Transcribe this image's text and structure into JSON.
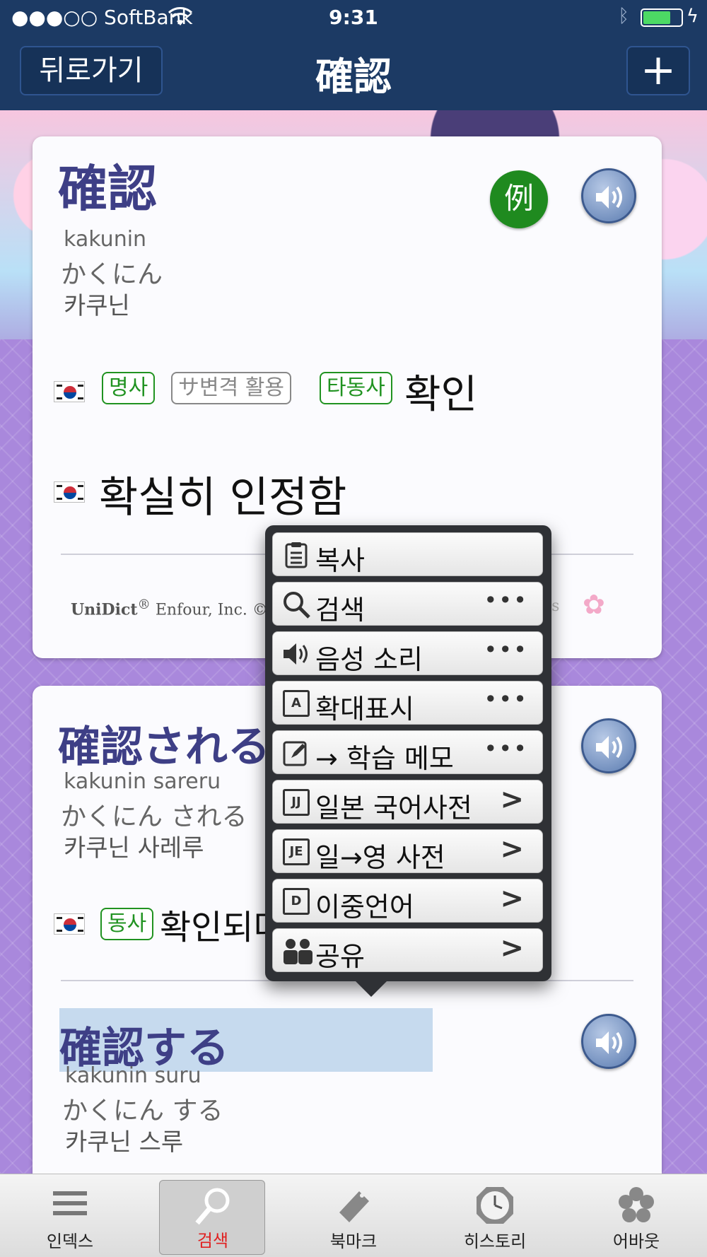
{
  "status_bar": {
    "carrier": "●●●○○ SoftBank",
    "time": "9:31",
    "wifi_icon": "wifi-icon",
    "bluetooth_icon": "bluetooth-icon",
    "battery_icon": "battery-icon",
    "charging_icon": "charging-icon"
  },
  "nav": {
    "back_label": "뒤로가기",
    "title": "確認",
    "add_label": "+"
  },
  "entries": [
    {
      "headword": "確認",
      "romaji": "kakunin",
      "kana": "かくにん",
      "hangul": "카쿠닌",
      "example_badge": "例",
      "senses": [
        {
          "tags": [
            "명사",
            "サ변격 활용",
            "타동사"
          ],
          "meaning": "확인"
        },
        {
          "tags": [],
          "meaning": "확실히 인정함"
        }
      ],
      "copyright_brand": "UniDict",
      "copyright_rest": " Enfour, Inc. ©",
      "copyright_tail": "lis"
    },
    {
      "headword": "確認される",
      "romaji": "kakunin sareru",
      "kana": "かくにん される",
      "hangul": "카쿠닌 사레루",
      "senses": [
        {
          "tags": [
            "동사"
          ],
          "meaning": "확인되다"
        }
      ]
    },
    {
      "headword": "確認する",
      "romaji": "kakunin suru",
      "kana": "かくにん する",
      "hangul": "카쿠닌 스루"
    }
  ],
  "popup_menu": {
    "items": [
      {
        "label": "복사",
        "icon": "clipboard-icon",
        "accessory": ""
      },
      {
        "label": "검색",
        "icon": "search-icon",
        "accessory": "•••"
      },
      {
        "label": "음성 소리",
        "icon": "speaker-icon",
        "accessory": "•••"
      },
      {
        "label": "확대표시",
        "icon": "zoom-a-icon",
        "accessory": "•••"
      },
      {
        "label": "→ 학습 메모",
        "icon": "pencil-note-icon",
        "accessory": "•••"
      },
      {
        "label": "일본 국어사전",
        "icon": "book-jj-icon",
        "accessory": ">"
      },
      {
        "label": "일→영 사전",
        "icon": "book-je-icon",
        "accessory": ">"
      },
      {
        "label": "이중언어",
        "icon": "book-d-icon",
        "accessory": ">"
      },
      {
        "label": "공유",
        "icon": "people-icon",
        "accessory": ">"
      }
    ]
  },
  "tab_bar": {
    "active": "검색",
    "active_color": "#e02020",
    "tabs": [
      {
        "label": "인덱스",
        "icon": "list-icon"
      },
      {
        "label": "검색",
        "icon": "magnifier-icon"
      },
      {
        "label": "북마크",
        "icon": "bookmark-icon"
      },
      {
        "label": "히스토리",
        "icon": "clock-icon"
      },
      {
        "label": "어바웃",
        "icon": "sakura-icon"
      }
    ]
  },
  "colors": {
    "navbar": "#1c3a64",
    "headword": "#3e3f86",
    "tag_green": "#219321",
    "lattice": "#a988dc"
  }
}
